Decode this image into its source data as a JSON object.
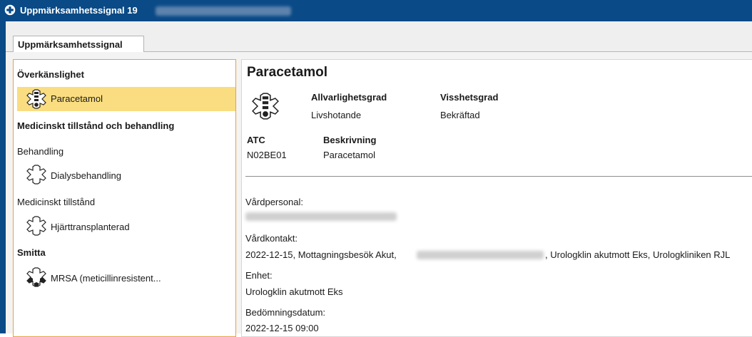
{
  "window": {
    "title": "Uppmärksamhetssignal 19"
  },
  "tabs": [
    {
      "label": "Uppmärksamhetssignal",
      "active": true
    }
  ],
  "sidebar": {
    "sections": [
      {
        "heading": "Överkänslighet",
        "items": [
          {
            "label": "Paracetamol",
            "icon": "medical-alert-icon",
            "selected": true
          }
        ]
      },
      {
        "heading": "Medicinskt tillstånd och behandling",
        "items": []
      },
      {
        "heading": "Behandling",
        "items": [
          {
            "label": "Dialysbehandling",
            "icon": "medical-alert-outline-icon"
          }
        ]
      },
      {
        "heading": "Medicinskt tillstånd",
        "items": [
          {
            "label": "Hjärttransplanterad",
            "icon": "medical-alert-outline-icon"
          }
        ]
      },
      {
        "heading": "Smitta",
        "items": [
          {
            "label": "MRSA (meticillinresistent...",
            "icon": "infection-alert-icon"
          }
        ]
      }
    ]
  },
  "detail": {
    "title": "Paracetamol",
    "severity_label": "Allvarlighetsgrad",
    "severity_value": "Livshotande",
    "certainty_label": "Visshetsgrad",
    "certainty_value": "Bekräftad",
    "atc_label": "ATC",
    "atc_value": "N02BE01",
    "description_label": "Beskrivning",
    "description_value": "Paracetamol",
    "staff_label": "Vårdpersonal:",
    "contact_label": "Vårdkontakt:",
    "contact_value_part1": "2022-12-15, Mottagningsbesök Akut,",
    "contact_value_part2": ", Urologklin akutmott Eks, Urologkliniken RJL",
    "unit_label": "Enhet:",
    "unit_value": "Urologklin akutmott Eks",
    "assessment_date_label": "Bedömningsdatum:",
    "assessment_date_value": "2022-12-15 09:00"
  },
  "colors": {
    "titlebar": "#0a4a86",
    "selection": "#f9dd80",
    "panel_border": "#e9a23b"
  }
}
